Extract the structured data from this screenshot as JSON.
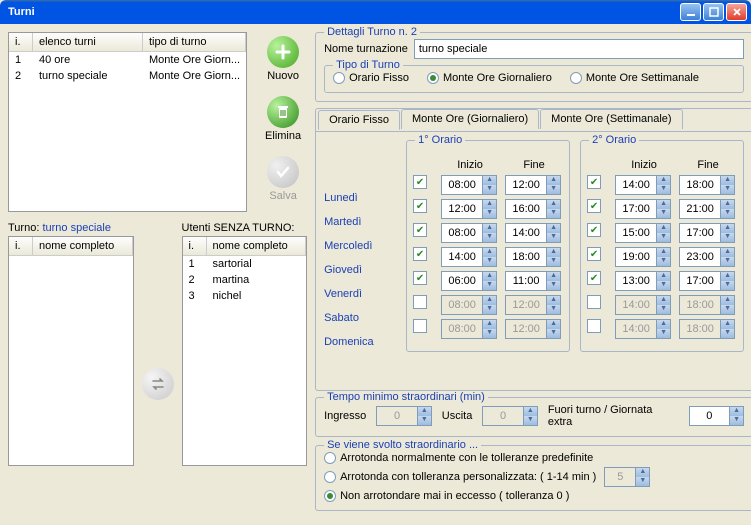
{
  "window": {
    "title": "Turni"
  },
  "shiftList": {
    "cols": {
      "i": "i.",
      "name": "elenco turni",
      "type": "tipo di turno"
    },
    "rows": [
      {
        "i": "1",
        "name": "40 ore",
        "type": "Monte Ore Giorn..."
      },
      {
        "i": "2",
        "name": "turno speciale",
        "type": "Monte Ore Giorn..."
      }
    ]
  },
  "buttons": {
    "new": "Nuovo",
    "delete": "Elimina",
    "save": "Salva"
  },
  "assigned": {
    "labelPrefix": "Turno:",
    "labelValue": "turno speciale",
    "col_i": "i.",
    "col_n": "nome completo"
  },
  "unassigned": {
    "label": "Utenti SENZA TURNO:",
    "col_i": "i.",
    "col_n": "nome completo",
    "rows": [
      {
        "i": "1",
        "name": "sartorial"
      },
      {
        "i": "2",
        "name": "martina"
      },
      {
        "i": "3",
        "name": "nichel"
      }
    ]
  },
  "detail": {
    "title": "Dettagli Turno n. 2",
    "nameLabel": "Nome turnazione",
    "nameValue": "turno speciale",
    "typeGroup": "Tipo di Turno",
    "types": {
      "fixed": "Orario Fisso",
      "daily": "Monte Ore Giornaliero",
      "weekly": "Monte Ore Settimanale"
    },
    "selectedType": "daily"
  },
  "tabs": {
    "fixed": "Orario Fisso",
    "daily": "Monte Ore (Giornaliero)",
    "weekly": "Monte Ore (Settimanale)"
  },
  "sched": {
    "h1": "1° Orario",
    "h2": "2° Orario",
    "start": "Inizio",
    "end": "Fine",
    "days": [
      {
        "label": "Lunedì",
        "a_on": true,
        "a_s": "08:00",
        "a_e": "12:00",
        "b_on": true,
        "b_s": "14:00",
        "b_e": "18:00"
      },
      {
        "label": "Martedì",
        "a_on": true,
        "a_s": "12:00",
        "a_e": "16:00",
        "b_on": true,
        "b_s": "17:00",
        "b_e": "21:00"
      },
      {
        "label": "Mercoledì",
        "a_on": true,
        "a_s": "08:00",
        "a_e": "14:00",
        "b_on": true,
        "b_s": "15:00",
        "b_e": "17:00"
      },
      {
        "label": "Giovedì",
        "a_on": true,
        "a_s": "14:00",
        "a_e": "18:00",
        "b_on": true,
        "b_s": "19:00",
        "b_e": "23:00"
      },
      {
        "label": "Venerdì",
        "a_on": true,
        "a_s": "06:00",
        "a_e": "11:00",
        "b_on": true,
        "b_s": "13:00",
        "b_e": "17:00"
      },
      {
        "label": "Sabato",
        "a_on": false,
        "a_s": "08:00",
        "a_e": "12:00",
        "b_on": false,
        "b_s": "14:00",
        "b_e": "18:00"
      },
      {
        "label": "Domenica",
        "a_on": false,
        "a_s": "08:00",
        "a_e": "12:00",
        "b_on": false,
        "b_s": "14:00",
        "b_e": "18:00"
      }
    ]
  },
  "overtime": {
    "title": "Tempo minimo straordinari (min)",
    "in": "Ingresso",
    "inVal": "0",
    "out": "Uscita",
    "outVal": "0",
    "extra": "Fuori turno / Giornata extra",
    "extraVal": "0"
  },
  "rounding": {
    "title": "Se viene svolto straordinario ...",
    "opt1": "Arrotonda normalmente con le tolleranze predefinite",
    "opt2": "Arrotonda con tolleranza personalizzata: ( 1-14 min )",
    "opt2val": "5",
    "opt3": "Non arrotondare mai in eccesso  ( tolleranza 0 )",
    "selected": "opt3"
  }
}
